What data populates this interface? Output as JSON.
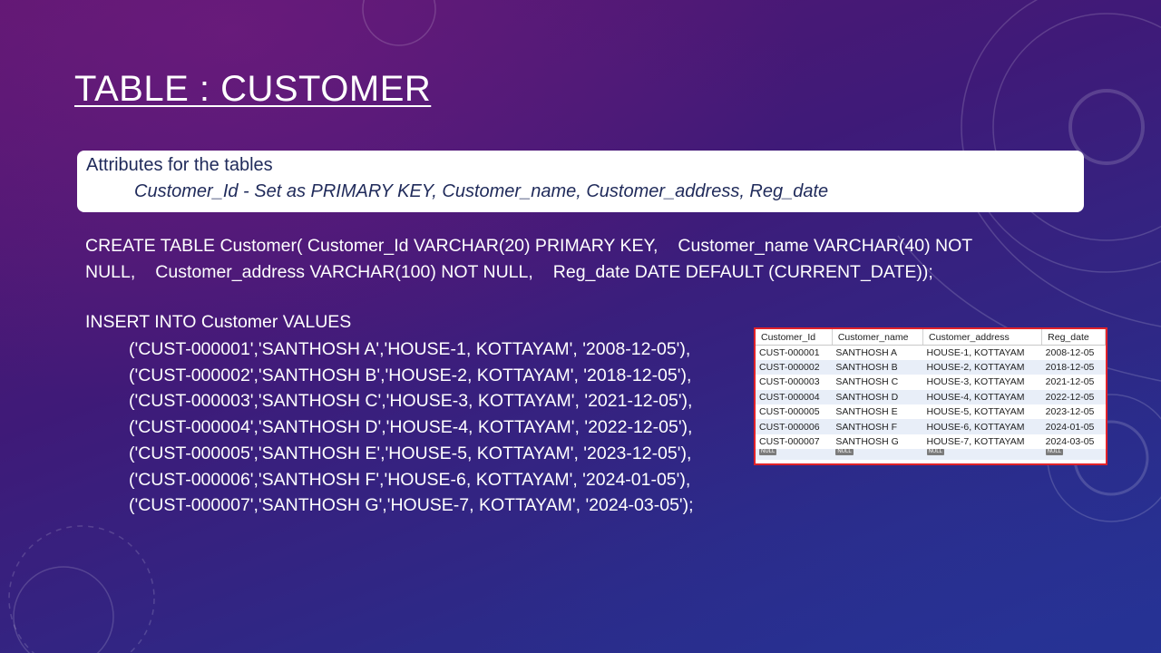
{
  "slide": {
    "title": "TABLE : CUSTOMER",
    "attributes": {
      "heading": "Attributes for the tables",
      "list": "Customer_Id - Set as PRIMARY KEY, Customer_name, Customer_address, Reg_date"
    },
    "create_statement": {
      "line1": "CREATE TABLE Customer( Customer_Id VARCHAR(20) PRIMARY KEY,",
      "line1b": "Customer_name VARCHAR(40) NOT",
      "line2a": "NULL,",
      "line2b": "Customer_address VARCHAR(100) NOT NULL,",
      "line2c": "Reg_date DATE DEFAULT (CURRENT_DATE));"
    },
    "insert_statement": {
      "head": "INSERT INTO Customer VALUES",
      "rows": [
        "('CUST-000001','SANTHOSH A','HOUSE-1, KOTTAYAM', '2008-12-05'),",
        "('CUST-000002','SANTHOSH B','HOUSE-2, KOTTAYAM', '2018-12-05'),",
        "('CUST-000003','SANTHOSH C','HOUSE-3, KOTTAYAM', '2021-12-05'),",
        "('CUST-000004','SANTHOSH D','HOUSE-4, KOTTAYAM', '2022-12-05'),",
        "('CUST-000005','SANTHOSH E','HOUSE-5, KOTTAYAM', '2023-12-05'),",
        "('CUST-000006','SANTHOSH F','HOUSE-6, KOTTAYAM', '2024-01-05'),",
        "('CUST-000007','SANTHOSH G','HOUSE-7, KOTTAYAM', '2024-03-05');"
      ]
    },
    "result_table": {
      "columns": [
        "Customer_Id",
        "Customer_name",
        "Customer_address",
        "Reg_date"
      ],
      "rows": [
        [
          "CUST-000001",
          "SANTHOSH A",
          "HOUSE-1, KOTTAYAM",
          "2008-12-05"
        ],
        [
          "CUST-000002",
          "SANTHOSH B",
          "HOUSE-2, KOTTAYAM",
          "2018-12-05"
        ],
        [
          "CUST-000003",
          "SANTHOSH C",
          "HOUSE-3, KOTTAYAM",
          "2021-12-05"
        ],
        [
          "CUST-000004",
          "SANTHOSH D",
          "HOUSE-4, KOTTAYAM",
          "2022-12-05"
        ],
        [
          "CUST-000005",
          "SANTHOSH E",
          "HOUSE-5, KOTTAYAM",
          "2023-12-05"
        ],
        [
          "CUST-000006",
          "SANTHOSH F",
          "HOUSE-6, KOTTAYAM",
          "2024-01-05"
        ],
        [
          "CUST-000007",
          "SANTHOSH G",
          "HOUSE-7, KOTTAYAM",
          "2024-03-05"
        ]
      ],
      "null_label": "NULL",
      "border_color": "#e0222a"
    }
  },
  "colors": {
    "background_top": "#5b1670",
    "background_bottom": "#243394",
    "box_text": "#1f2a5a"
  }
}
